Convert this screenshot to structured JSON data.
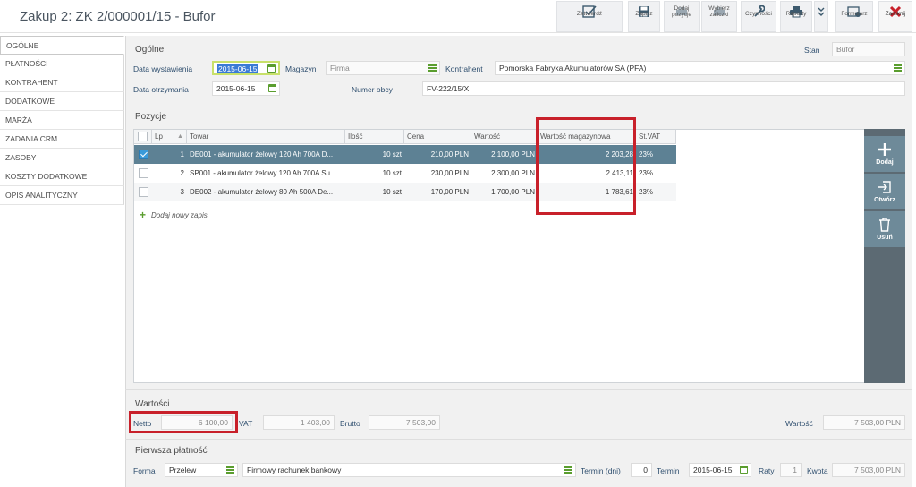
{
  "window": {
    "title": "Zakup 2: ZK 2/000001/15 - Bufor"
  },
  "toolbar": {
    "zatwierdz": "Zatwierdź",
    "zapisz": "Zapisz",
    "dodaj_pozycje": "Dodaj pozycje",
    "wybierz_zaliczki": "Wybierz zaliczki",
    "czynnosci": "Czynności",
    "raporty": "Raporty",
    "formularz": "Formularz",
    "zamknij": "Zamknij"
  },
  "sidebar": {
    "items": [
      {
        "label": "OGÓLNE"
      },
      {
        "label": "PŁATNOŚCI"
      },
      {
        "label": "KONTRAHENT"
      },
      {
        "label": "DODATKOWE"
      },
      {
        "label": "MARŻA"
      },
      {
        "label": "ZADANIA CRM"
      },
      {
        "label": "ZASOBY"
      },
      {
        "label": "KOSZTY DODATKOWE"
      },
      {
        "label": "OPIS ANALITYCZNY"
      }
    ]
  },
  "general": {
    "section_title": "Ogólne",
    "stan_label": "Stan",
    "stan_value": "Bufor",
    "data_wystawienia_label": "Data wystawienia",
    "data_wystawienia_value": "2015-06-15",
    "magazyn_label": "Magazyn",
    "magazyn_value": "Firma",
    "kontrahent_label": "Kontrahent",
    "kontrahent_value": "Pomorska Fabryka Akumulatorów SA (PFA)",
    "data_otrzymania_label": "Data otrzymania",
    "data_otrzymania_value": "2015-06-15",
    "numer_obcy_label": "Numer obcy",
    "numer_obcy_value": "FV-222/15/X"
  },
  "positions": {
    "section_title": "Pozycje",
    "columns": [
      "Lp",
      "Towar",
      "Ilość",
      "Cena",
      "Wartość",
      "Wartość magazynowa",
      "St.VAT"
    ],
    "rows": [
      {
        "lp": "1",
        "towar": "DE001 - akumulator żelowy 120 Ah 700A D...",
        "ilosc": "10 szt",
        "cena": "210,00 PLN",
        "wartosc": "2 100,00 PLN",
        "wartosc_mag": "2 203,28",
        "vat": "23%",
        "checked": true
      },
      {
        "lp": "2",
        "towar": "SP001 - akumulator żelowy 120 Ah 700A Su...",
        "ilosc": "10 szt",
        "cena": "230,00 PLN",
        "wartosc": "2 300,00 PLN",
        "wartosc_mag": "2 413,11",
        "vat": "23%",
        "checked": false
      },
      {
        "lp": "3",
        "towar": "DE002 - akumulator żelowy 80 Ah 500A De...",
        "ilosc": "10 szt",
        "cena": "170,00 PLN",
        "wartosc": "1 700,00 PLN",
        "wartosc_mag": "1 783,61",
        "vat": "23%",
        "checked": false
      }
    ],
    "add_new": "Dodaj nowy zapis",
    "actions": {
      "dodaj": "Dodaj",
      "otworz": "Otwórz",
      "usun": "Usuń"
    }
  },
  "values": {
    "section_title": "Wartości",
    "netto_label": "Netto",
    "netto_value": "6 100,00",
    "vat_label": "VAT",
    "vat_value": "1 403,00",
    "brutto_label": "Brutto",
    "brutto_value": "7 503,00",
    "wartosc_label": "Wartość",
    "wartosc_value": "7 503,00 PLN"
  },
  "payment": {
    "section_title": "Pierwsza płatność",
    "forma_label": "Forma",
    "forma_value": "Przelew",
    "account_value": "Firmowy rachunek bankowy",
    "termin_dni_label": "Termin (dni)",
    "termin_dni_value": "0",
    "termin_label": "Termin",
    "termin_value": "2015-06-15",
    "raty_label": "Raty",
    "raty_value": "1",
    "kwota_label": "Kwota",
    "kwota_value": "7 503,00 PLN"
  },
  "colors": {
    "accent_red": "#c8202a",
    "selected_row": "#5d8194",
    "action_panel": "#5c6a73",
    "green_icon": "#5a9d2e"
  }
}
